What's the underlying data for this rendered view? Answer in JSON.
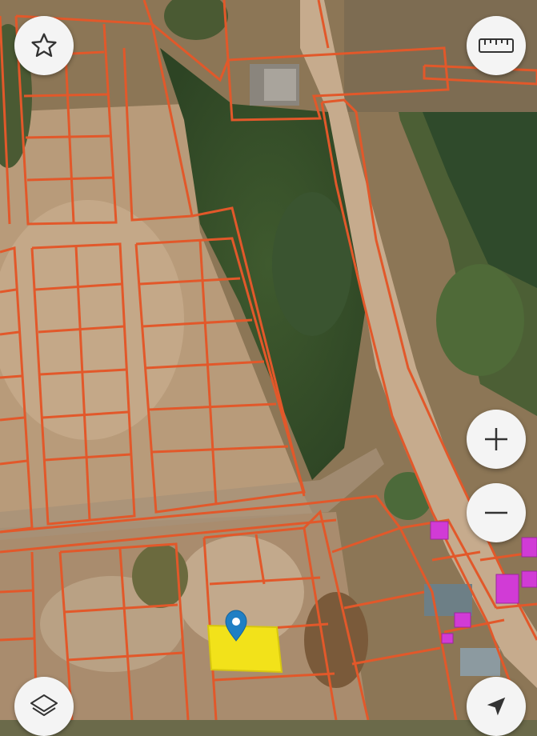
{
  "map": {
    "type": "satellite cadastral map",
    "parcel_outline_color": "#e2582a",
    "selected_parcel_color": "#f2e21a",
    "building_highlight_color": "#d13bd6",
    "marker_color": "#1f7fc4"
  },
  "controls": {
    "favorite": {
      "icon": "star-icon"
    },
    "ruler": {
      "icon": "ruler-icon"
    },
    "zoom_in": {
      "icon": "plus-icon"
    },
    "zoom_out": {
      "icon": "minus-icon"
    },
    "layers": {
      "icon": "layers-icon"
    },
    "locate": {
      "icon": "navigation-arrow-icon"
    }
  }
}
